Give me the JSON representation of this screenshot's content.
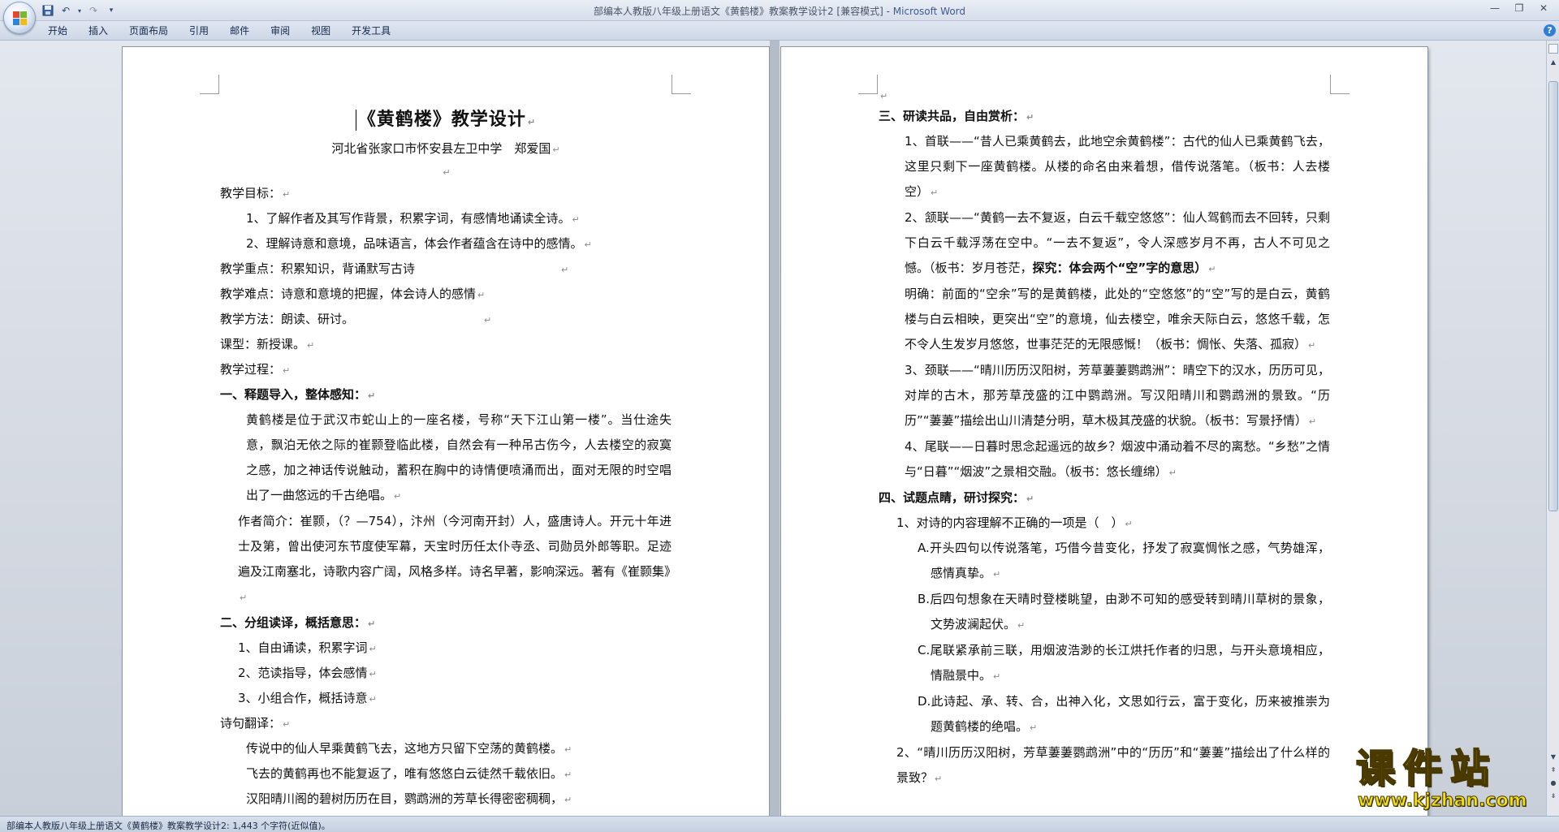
{
  "window": {
    "title": "部编本人教版八年级上册语文《黄鹤楼》教案教学设计2 [兼容模式] - ",
    "app_name": "Microsoft Word"
  },
  "qat": {
    "save_icon": "save-icon",
    "undo_icon": "undo-icon",
    "redo_icon": "redo-icon",
    "customize_icon": "customize-qat-icon"
  },
  "ribbon": {
    "tabs": [
      "开始",
      "插入",
      "页面布局",
      "引用",
      "邮件",
      "审阅",
      "视图",
      "开发工具"
    ]
  },
  "colors": {
    "accent": "#3d5c93",
    "ribbon_bg": "#dfe6f1",
    "watermark_yellow": "#f3e10c"
  },
  "left_page": {
    "title": "《黄鹤楼》教学设计",
    "author": "河北省张家口市怀安县左卫中学　郑爱国",
    "lines": {
      "goals_label": "教学目标：",
      "goal1": "1、了解作者及其写作背景，积累字词，有感情地诵读全诗。",
      "goal2": "2、理解诗意和意境，品味语言，体会作者蕴含在诗中的感情。",
      "focus": "教学重点：积累知识，背诵默写古诗",
      "difficulty": "教学难点：诗意和意境的把握，体会诗人的感情",
      "method": "教学方法：朗读、研讨。",
      "type": "课型：新授课。",
      "process": "教学过程：",
      "sec1": "一、释题导入，整体感知：",
      "intro": "黄鹤楼是位于武汉市蛇山上的一座名楼，号称“天下江山第一楼”。当仕途失意，飘泊无依之际的崔颢登临此楼，自然会有一种吊古伤今，人去楼空的寂寞之感，加之神话传说触动，蓄积在胸中的诗情便喷涌而出，面对无限的时空唱出了一曲悠远的千古绝唱。",
      "author_intro": "作者简介：崔颢，（？—754），汴州（今河南开封）人，盛唐诗人。开元十年进士及第，曾出使河东节度使军幕，天宝时历任太仆寺丞、司勋员外郎等职。足迹遍及江南塞北，诗歌内容广阔，风格多样。诗名早著，影响深远。著有《崔颢集》",
      "sec2": "二、分组读译，概括意思：",
      "step1": "1、自由诵读，积累字词",
      "step2": "2、范读指导，体会感情",
      "step3": "3、小组合作，概括诗意",
      "translation": "诗句翻译：",
      "t1": "传说中的仙人早乘黄鹤飞去，这地方只留下空荡的黄鹤楼。",
      "t2": "飞去的黄鹤再也不能复返了，唯有悠悠白云徒然千载依旧。",
      "t3": "汉阳晴川阁的碧树历历在目，鹦鹉洲的芳草长得密密稠稠，"
    }
  },
  "right_page": {
    "lines": {
      "sec3": "三、研读共品，自由赏析：",
      "c1": "1、首联——“昔人已乘黄鹤去，此地空余黄鹤楼”：古代的仙人已乘黄鹤飞去，这里只剩下一座黄鹤楼。从楼的命名由来着想，借传说落笔。（板书：人去楼空）",
      "c2_a": "2、颔联——“黄鹤一去不复返，白云千载空悠悠”：仙人驾鹤而去不回转，只剩下白云千载浮荡在空中。“一去不复返”，令人深感岁月不再，古人不可见之憾。（板书：岁月苍茫，",
      "c2_b": "探究：体会两个“空”字的意思）",
      "clarify": "明确：前面的“空余”写的是黄鹤楼，此处的“空悠悠”的“空”写的是白云，黄鹤楼与白云相映，更突出“空”的意境，仙去楼空，唯余天际白云，悠悠千载，怎不令人生发岁月悠悠，世事茫茫的无限感慨！（板书：惆怅、失落、孤寂）",
      "c3": "3、颈联——“晴川历历汉阳树，芳草萋萋鹦鹉洲”：晴空下的汉水，历历可见，对岸的古木，那芳草茂盛的江中鹦鹉洲。写汉阳晴川和鹦鹉洲的景致。“历历”“萋萋”描绘出山川清楚分明，草木极其茂盛的状貌。（板书：写景抒情）",
      "c4": "4、尾联——日暮时思念起遥远的故乡？烟波中涌动着不尽的离愁。“乡愁”之情与“日暮”“烟波”之景相交融。（板书：悠长缠绵）",
      "sec4": "四、试题点睛，研讨探究：",
      "q1": "1、对诗的内容理解不正确的一项是（　）",
      "qa": "A.开头四句以传说落笔，巧借今昔变化，抒发了寂寞惆怅之感，气势雄浑，感情真挚。",
      "qb": "B.后四句想象在天晴时登楼眺望，由渺不可知的感受转到晴川草树的景象，文势波澜起伏。",
      "qc": "C.尾联紧承前三联，用烟波浩渺的长江烘托作者的归思，与开头意境相应，情融景中。",
      "qd": "D.此诗起、承、转、合，出神入化，文思如行云，富于变化，历来被推崇为题黄鹤楼的绝唱。",
      "q2": "2、“晴川历历汉阳树，芳草萋萋鹦鹉洲”中的“历历”和“萋萋”描绘出了什么样的景致？"
    }
  },
  "status": {
    "text": "部编本人教版八年级上册语文《黄鹤楼》教案教学设计2: 1,443 个字符(近似值)。"
  },
  "watermark": {
    "main": "课件站",
    "url": "www.kjzhan.com"
  }
}
